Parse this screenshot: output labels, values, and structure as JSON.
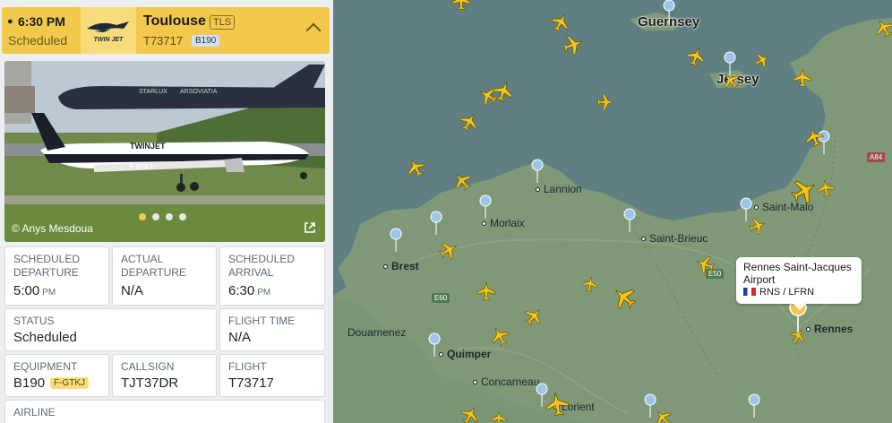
{
  "header": {
    "time": "6:30 PM",
    "status": "Scheduled",
    "airline_logo_text": "TWIN JET",
    "city": "Toulouse",
    "iata": "TLS",
    "flight_number": "T73717",
    "aircraft_type": "B190"
  },
  "photo": {
    "credit": "© Anys Mesdoua",
    "slide_count": 4,
    "active_slide": 1,
    "bg_tail_text": "ARSOVIATIA",
    "bg_fuselage_text": "STARLUX",
    "plane_title": "TWINJET",
    "plane_reg": "F-GTKJ"
  },
  "details": {
    "scheduled_departure": {
      "label": "SCHEDULED DEPARTURE",
      "value": "5:00",
      "suffix": "PM"
    },
    "actual_departure": {
      "label": "ACTUAL DEPARTURE",
      "value": "N/A"
    },
    "scheduled_arrival": {
      "label": "SCHEDULED ARRIVAL",
      "value": "6:30",
      "suffix": "PM"
    },
    "status": {
      "label": "STATUS",
      "value": "Scheduled"
    },
    "flight_time": {
      "label": "FLIGHT TIME",
      "value": "N/A"
    },
    "equipment": {
      "label": "EQUIPMENT",
      "value": "B190",
      "registration": "F-GTKJ"
    },
    "callsign": {
      "label": "CALLSIGN",
      "value": "TJT37DR"
    },
    "flight": {
      "label": "FLIGHT",
      "value": "T73717"
    },
    "airline": {
      "label": "AIRLINE"
    }
  },
  "map": {
    "islands": {
      "guernsey": "Guernsey",
      "jersey": "Jersey"
    },
    "towns": {
      "lannion": "Lannion",
      "morlaix": "Morlaix",
      "saint_brieuc": "Saint-Brieuc",
      "saint_malo": "Saint-Malo",
      "brest": "Brest",
      "douarnenez": "Douarnenez",
      "quimper": "Quimper",
      "concarneau": "Concarneau",
      "lorient": "Lorient",
      "rennes": "Rennes"
    },
    "road_signs": {
      "a84": "A84",
      "e60": "E60",
      "e50": "E50"
    },
    "popup": {
      "airport_name": "Rennes Saint-Jacques Airport",
      "codes": "RNS / LFRN"
    }
  },
  "colors": {
    "accent": "#f2c94c",
    "aircraft": "#f5c518",
    "sea": "#5f7f83",
    "land": "#7f9878"
  }
}
